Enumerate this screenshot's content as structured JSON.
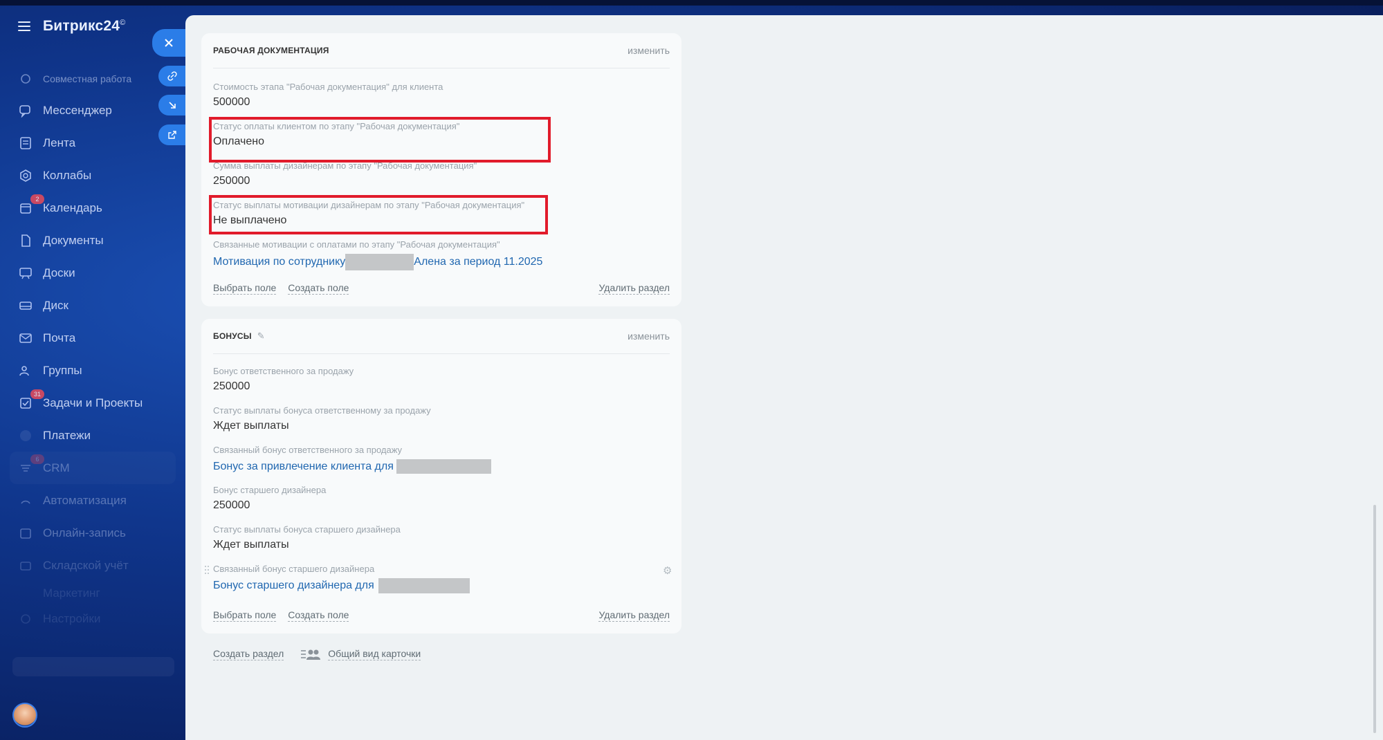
{
  "app": {
    "title": "Битрикс24",
    "title_mark": "©"
  },
  "sidebar": {
    "items": [
      {
        "label": "Совместная работа",
        "icon": "collab-cycle-icon",
        "badge": ""
      },
      {
        "label": "Мессенджер",
        "icon": "messenger-icon",
        "badge": ""
      },
      {
        "label": "Лента",
        "icon": "feed-icon",
        "badge": ""
      },
      {
        "label": "Коллабы",
        "icon": "collabs-icon",
        "badge": ""
      },
      {
        "label": "Календарь",
        "icon": "calendar-icon",
        "badge": "2"
      },
      {
        "label": "Документы",
        "icon": "documents-icon",
        "badge": ""
      },
      {
        "label": "Доски",
        "icon": "boards-icon",
        "badge": ""
      },
      {
        "label": "Диск",
        "icon": "disk-icon",
        "badge": ""
      },
      {
        "label": "Почта",
        "icon": "mail-icon",
        "badge": ""
      },
      {
        "label": "Группы",
        "icon": "groups-icon",
        "badge": ""
      },
      {
        "label": "Задачи и Проекты",
        "icon": "tasks-icon",
        "badge": "31"
      },
      {
        "label": "Платежи",
        "icon": "payments-icon",
        "badge": ""
      },
      {
        "label": "CRM",
        "icon": "crm-icon",
        "badge": "6"
      },
      {
        "label": "Автоматизация",
        "icon": "automation-icon",
        "badge": ""
      },
      {
        "label": "Онлайн-запись",
        "icon": "booking-icon",
        "badge": ""
      },
      {
        "label": "Складской учёт",
        "icon": "inventory-icon",
        "badge": ""
      },
      {
        "label": "Маркетинг",
        "icon": "marketing-icon",
        "badge": ""
      },
      {
        "label": "Настройки",
        "icon": "settings-icon",
        "badge": ""
      }
    ]
  },
  "sections": {
    "working_docs": {
      "title": "РАБОЧАЯ ДОКУМЕНТАЦИЯ",
      "edit": "изменить",
      "fields": [
        {
          "label": "Стоимость этапа \"Рабочая документация\" для клиента",
          "value": "500000"
        },
        {
          "label": "Статус оплаты клиентом по этапу \"Рабочая документация\"",
          "value": "Оплачено"
        },
        {
          "label": "Сумма выплаты дизайнерам по этапу \"Рабочая документация\"",
          "value": "250000"
        },
        {
          "label": "Статус выплаты мотивации дизайнерам по этапу \"Рабочая документация\"",
          "value": "Не выплачено"
        },
        {
          "label": "Связанные мотивации с оплатами по этапу \"Рабочая документация\"",
          "link_start": "Мотивация по сотруднику",
          "link_end": "Алена за период 11.2025"
        }
      ],
      "select_field": "Выбрать поле",
      "create_field": "Создать поле",
      "delete_section": "Удалить раздел"
    },
    "bonuses": {
      "title": "БОНУСЫ",
      "edit": "изменить",
      "fields": [
        {
          "label": "Бонус ответственного за продажу",
          "value": "250000"
        },
        {
          "label": "Статус выплаты бонуса ответственному за продажу",
          "value": "Ждет выплаты"
        },
        {
          "label": "Связанный бонус ответственного за продажу",
          "link": "Бонус за привлечение клиента для"
        },
        {
          "label": "Бонус старшего дизайнера",
          "value": "250000"
        },
        {
          "label": "Статус выплаты бонуса старшего дизайнера",
          "value": "Ждет выплаты"
        },
        {
          "label": "Связанный бонус старшего дизайнера",
          "link": "Бонус старшего дизайнера для"
        }
      ],
      "select_field": "Выбрать поле",
      "create_field": "Создать поле",
      "delete_section": "Удалить раздел"
    }
  },
  "bottom": {
    "create_section": "Создать раздел",
    "card_view": "Общий вид карточки"
  },
  "colors": {
    "accent": "#2b7de8",
    "highlight": "#e11b2b",
    "link": "#2067b0"
  }
}
